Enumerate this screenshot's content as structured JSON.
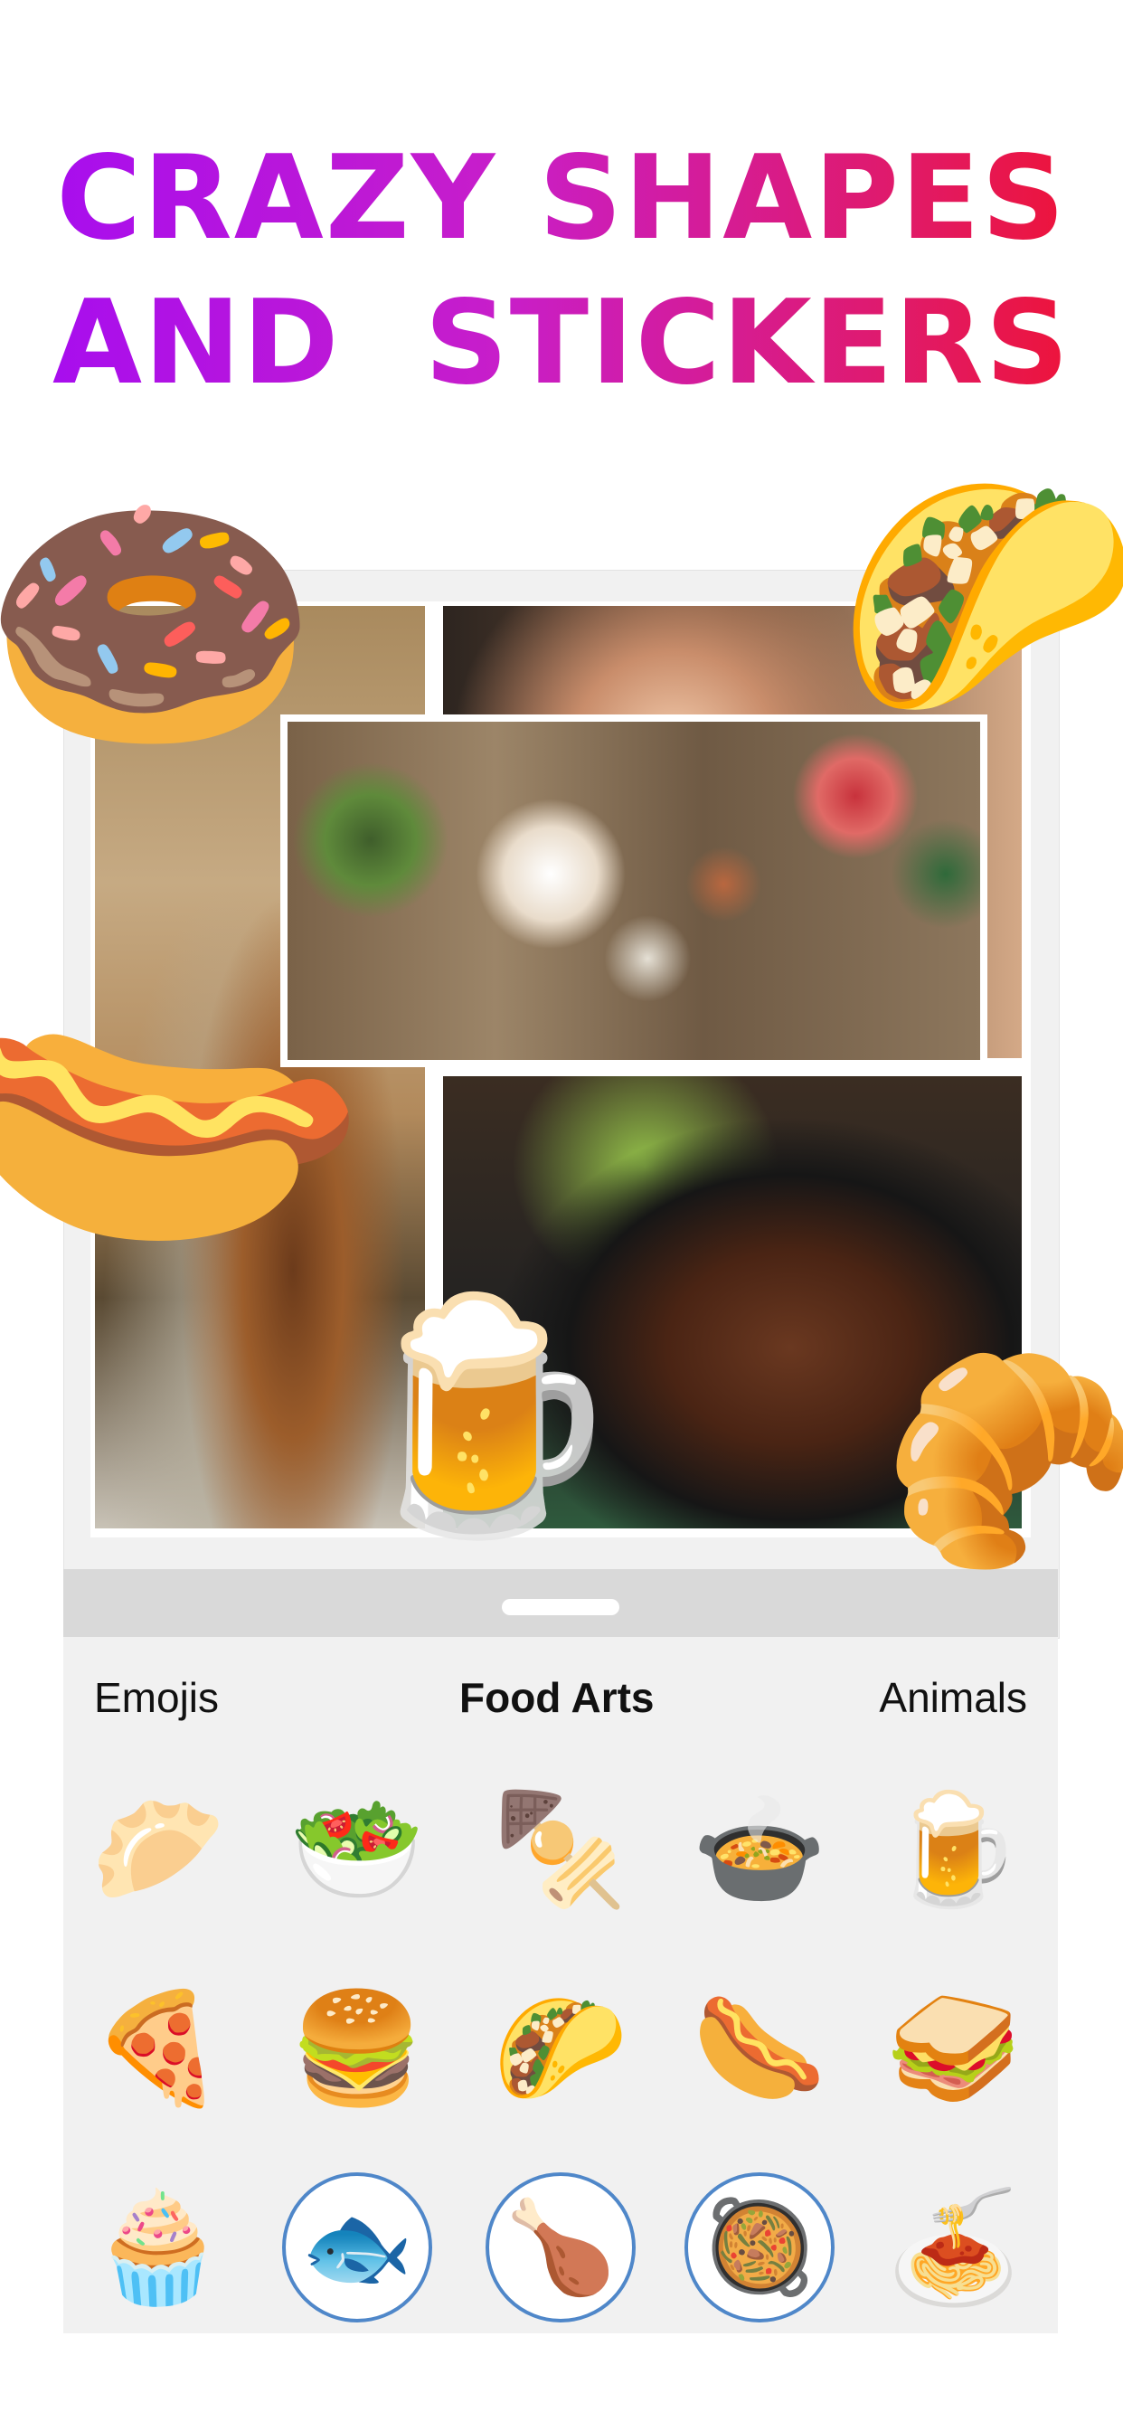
{
  "headline": {
    "line1": "CRAZY SHAPES",
    "line2": "AND  STICKERS"
  },
  "tabs": [
    {
      "label": "Emojis",
      "active": false
    },
    {
      "label": "Food Arts",
      "active": true
    },
    {
      "label": "Animals",
      "active": false
    }
  ],
  "stickers": [
    {
      "name": "dumplings",
      "glyph": "🥟"
    },
    {
      "name": "salad",
      "glyph": "🥗"
    },
    {
      "name": "kebab-skewers",
      "glyph": "🍢"
    },
    {
      "name": "soup-bowl",
      "glyph": "🍲"
    },
    {
      "name": "beer-mug",
      "glyph": "🍺"
    },
    {
      "name": "pizza",
      "glyph": "🍕"
    },
    {
      "name": "burger-fries",
      "glyph": "🍔"
    },
    {
      "name": "taco",
      "glyph": "🌮"
    },
    {
      "name": "hot-dog",
      "glyph": "🌭"
    },
    {
      "name": "sandwich",
      "glyph": "🥪"
    },
    {
      "name": "cupcake",
      "glyph": "🧁"
    },
    {
      "name": "grilled-fish",
      "glyph": "🐟"
    },
    {
      "name": "roast-chicken",
      "glyph": "🍗"
    },
    {
      "name": "stew",
      "glyph": "🥘"
    },
    {
      "name": "spaghetti",
      "glyph": "🍝"
    }
  ],
  "floating_stickers": {
    "donut": "🍩",
    "taco": "🌮",
    "hot_dog": "🌭",
    "beer": "🍺",
    "croissant": "🥐"
  },
  "colors": {
    "headline_gradient": [
      "#a40cf2",
      "#c81ec9",
      "#e01a6a",
      "#f1122c"
    ],
    "panel_background": "#f1f1f1",
    "plate_border": "#4f87c9"
  }
}
